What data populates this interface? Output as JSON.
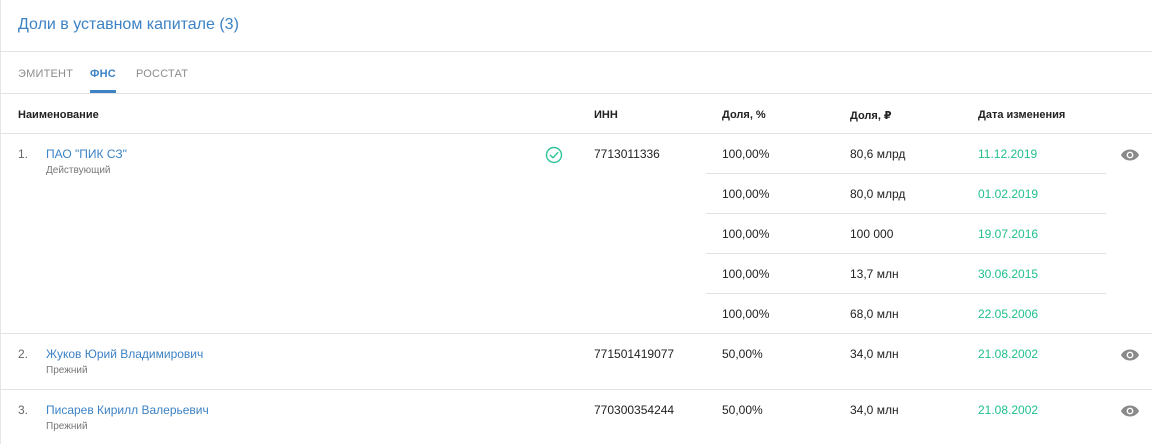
{
  "header": {
    "title": "Доли в уставном капитале (3)"
  },
  "tabs": [
    {
      "label": "ЭМИТЕНТ",
      "active": false
    },
    {
      "label": "ФНС",
      "active": true
    },
    {
      "label": "РОССТАТ",
      "active": false
    }
  ],
  "columns": {
    "name": "Наименование",
    "inn": "ИНН",
    "share_pct": "Доля, %",
    "share_rub": "Доля, ₽",
    "date": "Дата изменения"
  },
  "rows": [
    {
      "num": "1.",
      "name": "ПАО \"ПИК СЗ\"",
      "status": "Действующий",
      "verified": true,
      "inn": "7713011336",
      "history": [
        {
          "pct": "100,00%",
          "rub": "80,6 млрд",
          "date": "11.12.2019"
        },
        {
          "pct": "100,00%",
          "rub": "80,0 млрд",
          "date": "01.02.2019"
        },
        {
          "pct": "100,00%",
          "rub": "100 000",
          "date": "19.07.2016"
        },
        {
          "pct": "100,00%",
          "rub": "13,7 млн",
          "date": "30.06.2015"
        },
        {
          "pct": "100,00%",
          "rub": "68,0 млн",
          "date": "22.05.2006"
        }
      ]
    },
    {
      "num": "2.",
      "name": "Жуков Юрий Владимирович",
      "status": "Прежний",
      "verified": false,
      "inn": "771501419077",
      "history": [
        {
          "pct": "50,00%",
          "rub": "34,0 млн",
          "date": "21.08.2002"
        }
      ]
    },
    {
      "num": "3.",
      "name": "Писарев Кирилл Валерьевич",
      "status": "Прежний",
      "verified": false,
      "inn": "770300354244",
      "history": [
        {
          "pct": "50,00%",
          "rub": "34,0 млн",
          "date": "21.08.2002"
        }
      ]
    }
  ],
  "icons": {
    "verified": "check-circle-icon",
    "view": "eye-icon"
  },
  "colors": {
    "accent": "#3c82c4",
    "date": "#1fbf8f",
    "verified": "#2ec39a",
    "eye": "#8a8a8a"
  }
}
